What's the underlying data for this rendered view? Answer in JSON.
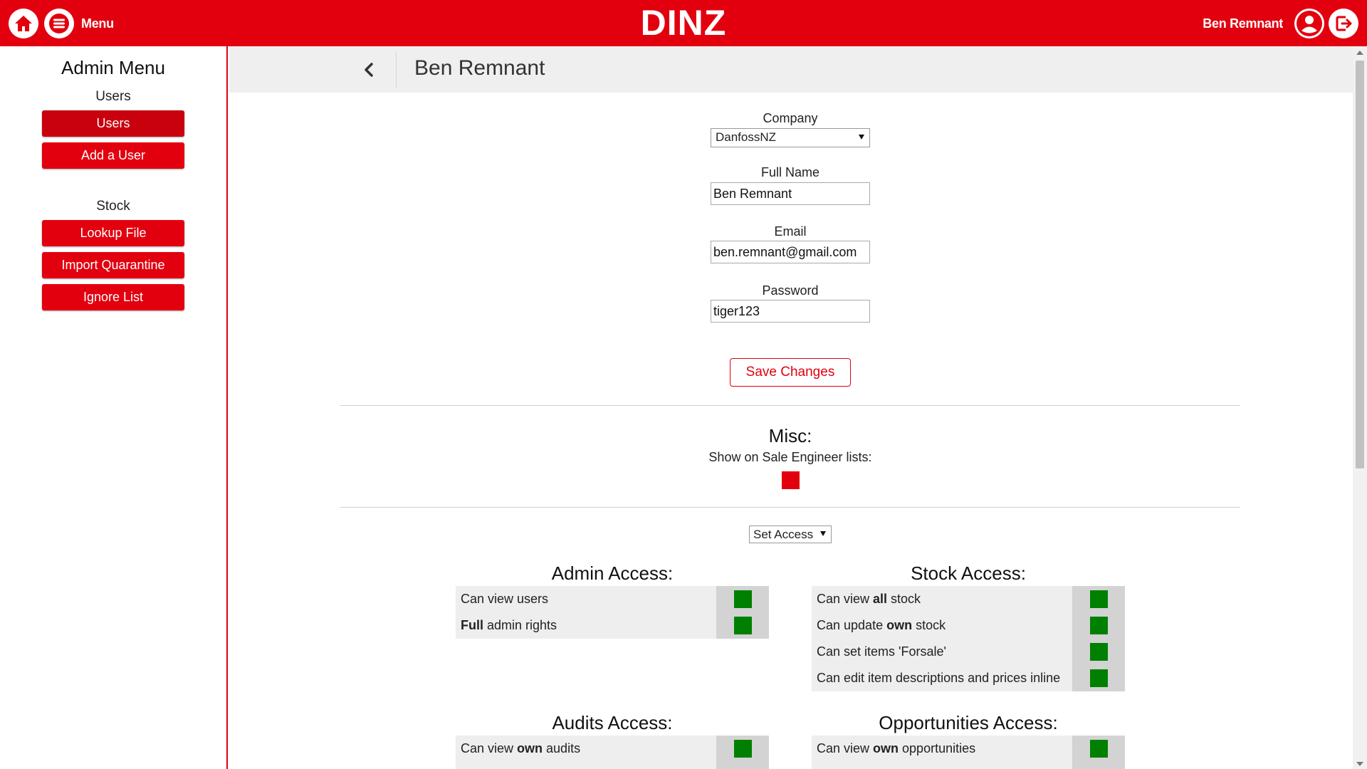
{
  "topbar": {
    "menu_label": "Menu",
    "brand": "DINZ",
    "user_name": "Ben Remnant",
    "icons": [
      "home-icon",
      "menu-icon",
      "user-icon",
      "logout-icon"
    ]
  },
  "sidebar": {
    "title": "Admin Menu",
    "sections": [
      {
        "heading": "Users",
        "items": [
          "Users",
          "Add a User"
        ]
      },
      {
        "heading": "Stock",
        "items": [
          "Lookup File",
          "Import Quarantine",
          "Ignore List"
        ]
      }
    ],
    "active_item": "Users"
  },
  "header": {
    "title": "Ben Remnant"
  },
  "form": {
    "company": {
      "label": "Company",
      "value": "DanfossNZ"
    },
    "full_name": {
      "label": "Full Name",
      "value": "Ben Remnant"
    },
    "email": {
      "label": "Email",
      "value": "ben.remnant@gmail.com"
    },
    "password": {
      "label": "Password",
      "value": "tiger123"
    },
    "save_label": "Save Changes"
  },
  "misc": {
    "title": "Misc:",
    "sale_engineer_label": "Show on Sale Engineer lists:",
    "sale_engineer_enabled": false
  },
  "set_access": {
    "value": "Set Access"
  },
  "access": {
    "admin": {
      "title": "Admin Access:",
      "perms": [
        {
          "pre": "Can view users",
          "bold": "",
          "post": "",
          "enabled": true
        },
        {
          "pre": "",
          "bold": "Full",
          "post": " admin rights",
          "enabled": true
        }
      ]
    },
    "stock": {
      "title": "Stock Access:",
      "perms": [
        {
          "pre": "Can view ",
          "bold": "all",
          "post": " stock",
          "enabled": true
        },
        {
          "pre": "Can update ",
          "bold": "own",
          "post": " stock",
          "enabled": true
        },
        {
          "pre": "Can set items 'Forsale'",
          "bold": "",
          "post": "",
          "enabled": true
        },
        {
          "pre": "Can edit item descriptions and prices inline",
          "bold": "",
          "post": "",
          "enabled": true
        }
      ]
    },
    "audits": {
      "title": "Audits Access:",
      "perms": [
        {
          "pre": "Can view ",
          "bold": "own",
          "post": " audits",
          "enabled": true
        }
      ]
    },
    "opportunities": {
      "title": "Opportunities Access:",
      "perms": [
        {
          "pre": "Can view ",
          "bold": "own",
          "post": " opportunities",
          "enabled": true
        }
      ]
    }
  },
  "colors": {
    "brand_red": "#e2000f",
    "on_green": "#008000",
    "off_red": "#e2000f"
  }
}
